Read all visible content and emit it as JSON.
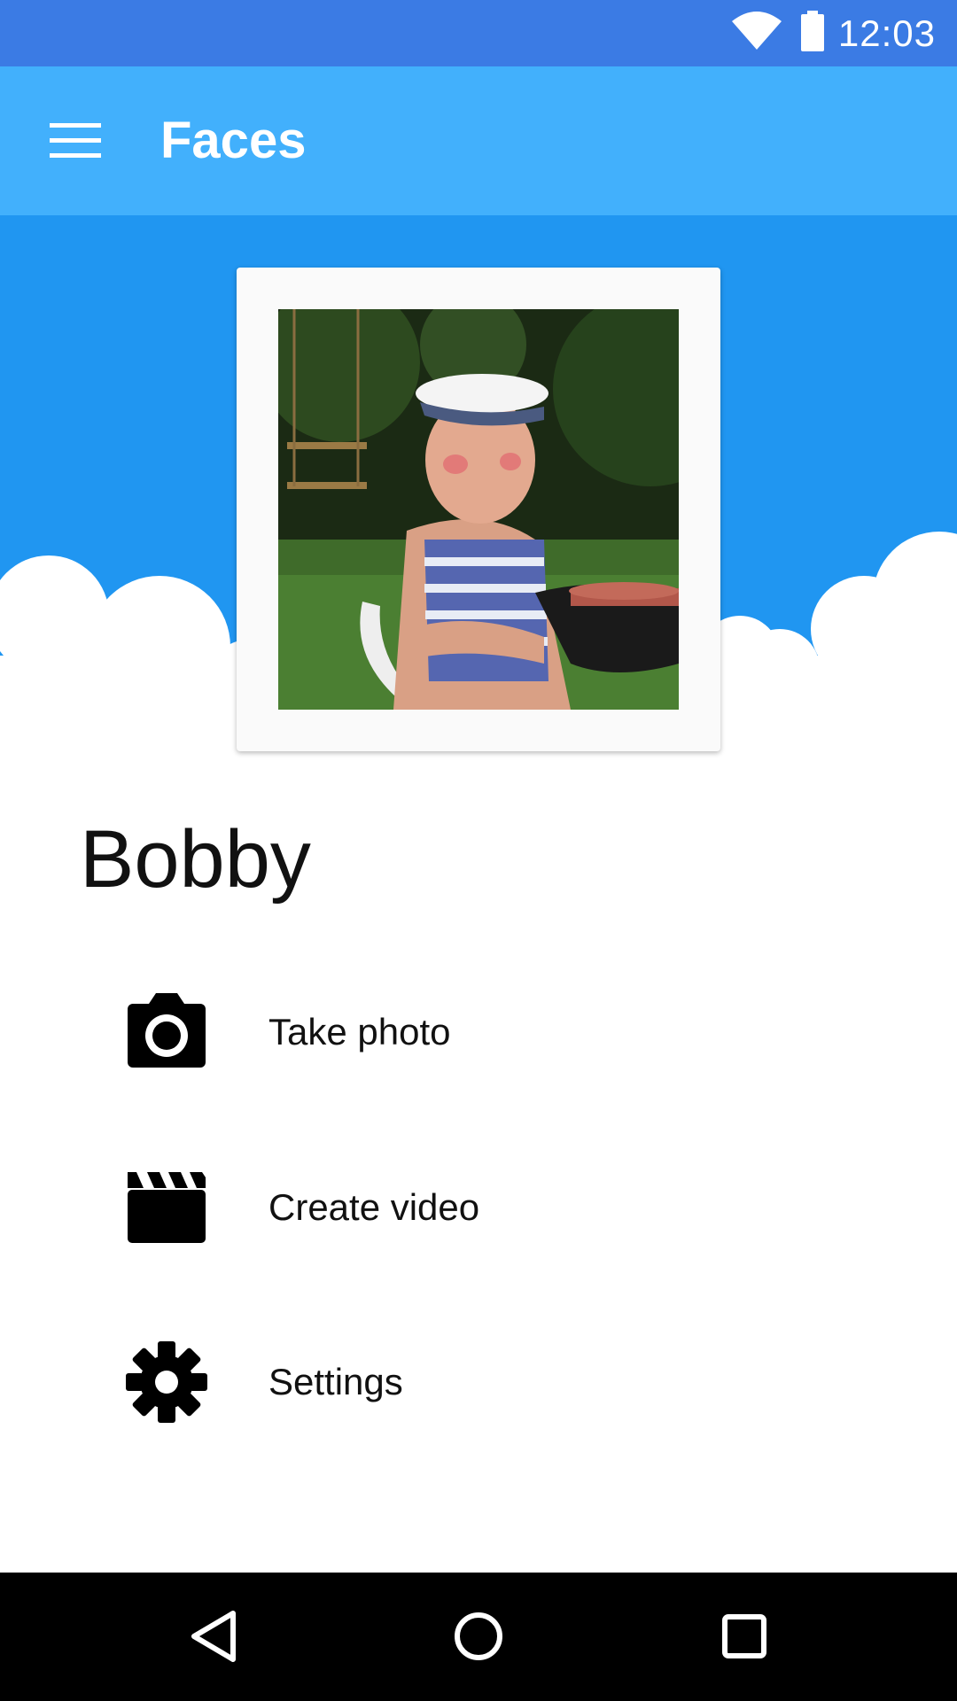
{
  "status_bar": {
    "time": "12:03",
    "icons": [
      "wifi-icon",
      "battery-icon"
    ]
  },
  "app_bar": {
    "title": "Faces",
    "menu_icon": "menu-icon"
  },
  "profile": {
    "name": "Bobby"
  },
  "actions": [
    {
      "label": "Take photo",
      "icon": "camera-icon"
    },
    {
      "label": "Create video",
      "icon": "clapperboard-icon"
    },
    {
      "label": "Settings",
      "icon": "gear-icon"
    }
  ],
  "nav_bar": {
    "buttons": [
      "back-icon",
      "home-icon",
      "recents-icon"
    ]
  },
  "colors": {
    "status_bar": "#3b7be4",
    "app_bar": "#42b0fc",
    "hero": "#2096f1"
  }
}
